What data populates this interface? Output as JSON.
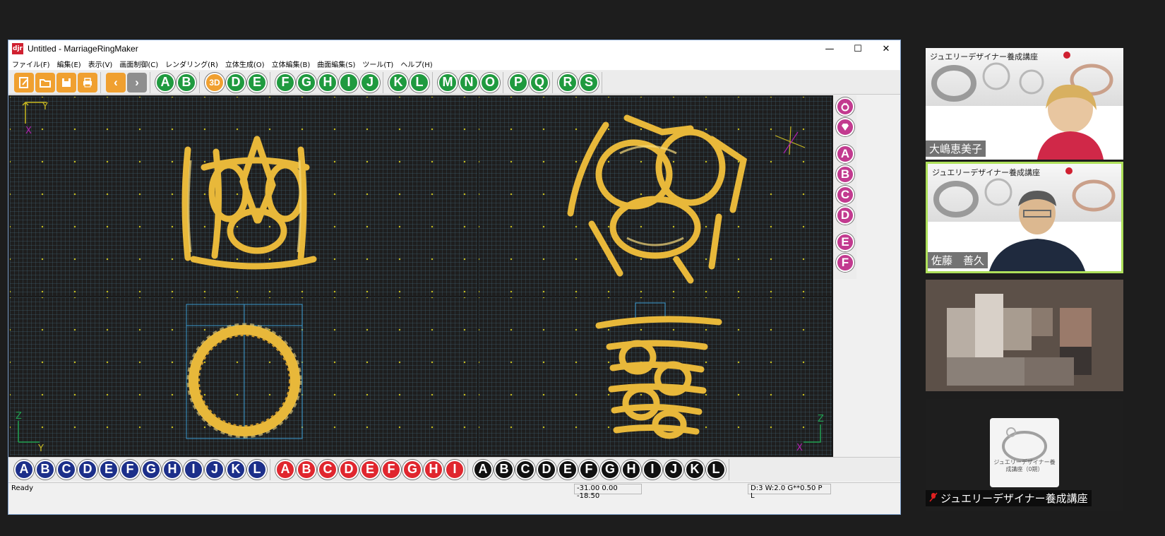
{
  "window": {
    "icon_text": "djr",
    "title": "Untitled - MarriageRingMaker",
    "minimize": "—",
    "maximize": "☐",
    "close": "✕"
  },
  "menu": [
    "ファイル(F)",
    "編集(E)",
    "表示(V)",
    "画面制御(C)",
    "レンダリング(R)",
    "立体生成(O)",
    "立体編集(B)",
    "曲面編集(S)",
    "ツール(T)",
    "ヘルプ(H)"
  ],
  "toolbar": {
    "file_icons": [
      "new-icon",
      "open-icon",
      "save-icon",
      "print-icon"
    ],
    "nav": [
      "‹",
      "›"
    ],
    "ab": [
      "A",
      "B"
    ],
    "three_d": "3D",
    "de": [
      "D",
      "E"
    ],
    "fj": [
      "F",
      "G",
      "H",
      "I",
      "J"
    ],
    "kl": [
      "K",
      "L"
    ],
    "mo": [
      "M",
      "N",
      "O"
    ],
    "pq": [
      "P",
      "Q"
    ],
    "rs": [
      "R",
      "S"
    ]
  },
  "viewports": {
    "front_axes": [
      "Y",
      "X"
    ],
    "side_axes": [
      "Z",
      "Y"
    ],
    "bottom_right_axes": [
      "Z",
      "X"
    ]
  },
  "sidebar": {
    "icons": [
      "ring-icon",
      "gem-icon"
    ],
    "letters": [
      "A",
      "B",
      "C",
      "D",
      "E",
      "F"
    ]
  },
  "bottom": {
    "navy": [
      "A",
      "B",
      "C",
      "D",
      "E",
      "F",
      "G",
      "H",
      "I",
      "J",
      "K",
      "L"
    ],
    "red": [
      "A",
      "B",
      "C",
      "D",
      "E",
      "F",
      "G",
      "H",
      "I"
    ],
    "black": [
      "A",
      "B",
      "C",
      "D",
      "E",
      "F",
      "G",
      "H",
      "I",
      "J",
      "K",
      "L"
    ]
  },
  "status": {
    "ready": "Ready",
    "coords": "-31.00 0.00 -18.50",
    "dims": "D:3 W:2.0  G**0.50 P   L"
  },
  "participants": [
    {
      "header": "ジュエリーデザイナー養成講座",
      "name": "大嶋恵美子"
    },
    {
      "header": "ジュエリーデザイナー養成講座",
      "name": "佐藤　善久"
    },
    {
      "header": "",
      "name": ""
    },
    {
      "header": "",
      "name": "ジュエリーデザイナー養成講座",
      "logo_text": "ジュエリーデザイナー養成講座（0期）"
    }
  ],
  "colors": {
    "gold": "#e8b83a",
    "green_btn": "#1f9a3f",
    "navy_btn": "#1c2f8a",
    "red_btn": "#e0262e",
    "magenta_btn": "#c23a8f",
    "active_border": "#aee05a"
  }
}
